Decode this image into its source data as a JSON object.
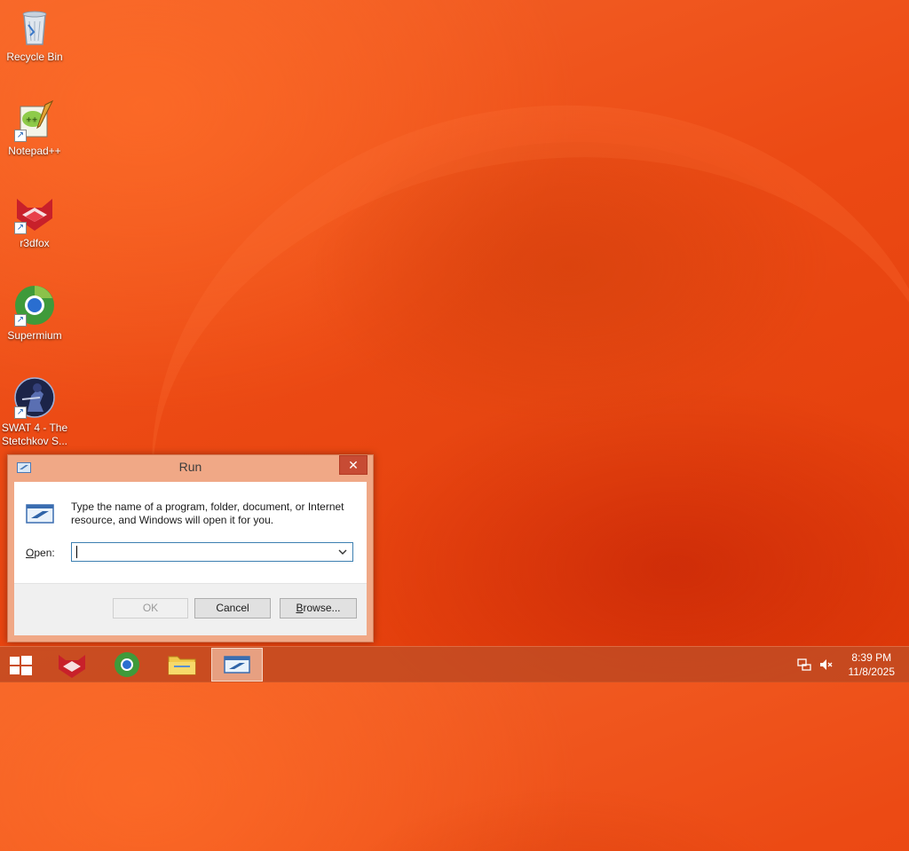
{
  "desktop": {
    "icons": [
      {
        "label": "Recycle Bin",
        "icon": "recycle-bin-icon",
        "shortcut": false
      },
      {
        "label": "Notepad++",
        "icon": "notepad-plus-plus-icon",
        "shortcut": true
      },
      {
        "label": "r3dfox",
        "icon": "r3dfox-icon",
        "shortcut": true
      },
      {
        "label": "Supermium",
        "icon": "supermium-icon",
        "shortcut": true
      },
      {
        "label": "SWAT 4 - The Stetchkov S...",
        "icon": "swat4-icon",
        "shortcut": true
      }
    ]
  },
  "run_dialog": {
    "title": "Run",
    "close_glyph": "✕",
    "description": "Type the name of a program, folder, document, or Internet resource, and Windows will open it for you.",
    "open_label_prefix": "O",
    "open_label_rest": "pen:",
    "open_value": "",
    "buttons": {
      "ok": "OK",
      "cancel": "Cancel",
      "browse_prefix": "B",
      "browse_rest": "rowse..."
    }
  },
  "taskbar": {
    "items": [
      {
        "name": "r3dfox",
        "icon": "r3dfox-icon"
      },
      {
        "name": "Supermium",
        "icon": "supermium-icon"
      },
      {
        "name": "File Explorer",
        "icon": "file-explorer-icon"
      },
      {
        "name": "Run",
        "icon": "run-icon",
        "active": true
      }
    ],
    "clock": {
      "time": "8:39 PM",
      "date": "11/8/2025"
    }
  },
  "colors": {
    "accent": "#f0a886",
    "close_button": "#c74b34",
    "wallpaper": "#ec4a14"
  }
}
